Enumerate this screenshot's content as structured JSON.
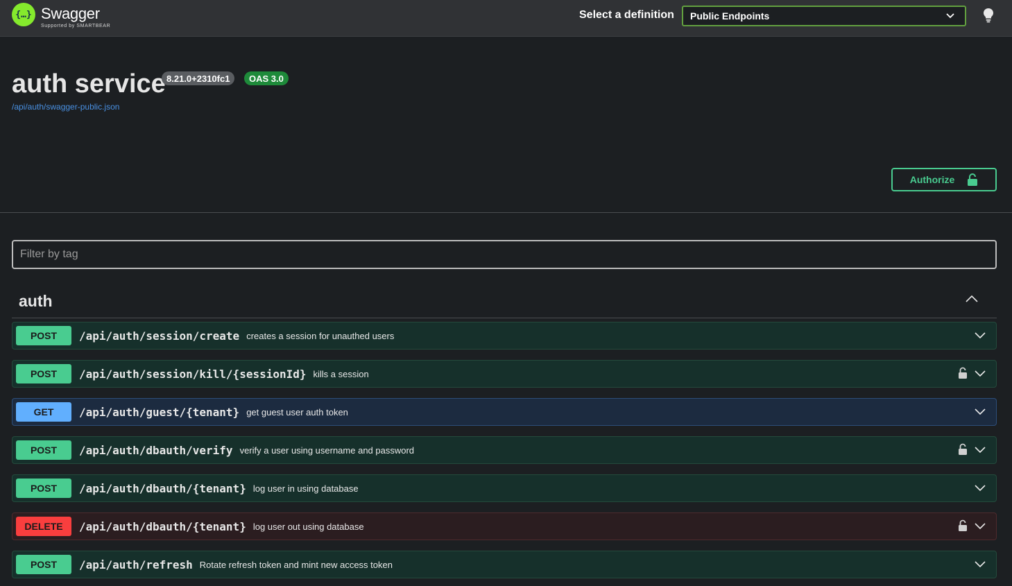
{
  "topbar": {
    "brand_name": "Swagger",
    "brand_sub": "Supported by SMARTBEAR",
    "select_label": "Select a definition",
    "selected_definition": "Public Endpoints"
  },
  "info": {
    "title": "auth service",
    "version_badge": "8.21.0+2310fc1",
    "oas_badge": "OAS 3.0",
    "spec_url": "/api/auth/swagger-public.json"
  },
  "authorize_label": "Authorize",
  "filter": {
    "placeholder": "Filter by tag",
    "value": ""
  },
  "tag": {
    "name": "auth"
  },
  "operations": [
    {
      "method": "POST",
      "path": "/api/auth/session/create",
      "summary": "creates a session for unauthed users",
      "locked": false
    },
    {
      "method": "POST",
      "path": "/api/auth/session/kill/{sessionId}",
      "summary": "kills a session",
      "locked": true
    },
    {
      "method": "GET",
      "path": "/api/auth/guest/{tenant}",
      "summary": "get guest user auth token",
      "locked": false
    },
    {
      "method": "POST",
      "path": "/api/auth/dbauth/verify",
      "summary": "verify a user using username and password",
      "locked": true
    },
    {
      "method": "POST",
      "path": "/api/auth/dbauth/{tenant}",
      "summary": "log user in using database",
      "locked": false
    },
    {
      "method": "DELETE",
      "path": "/api/auth/dbauth/{tenant}",
      "summary": "log user out using database",
      "locked": true
    },
    {
      "method": "POST",
      "path": "/api/auth/refresh",
      "summary": "Rotate refresh token and mint new access token",
      "locked": false
    }
  ],
  "colors": {
    "post": "#49cc90",
    "get": "#61affe",
    "delete": "#f93e3e",
    "brand_green": "#85ea2d",
    "link": "#4990e2"
  }
}
